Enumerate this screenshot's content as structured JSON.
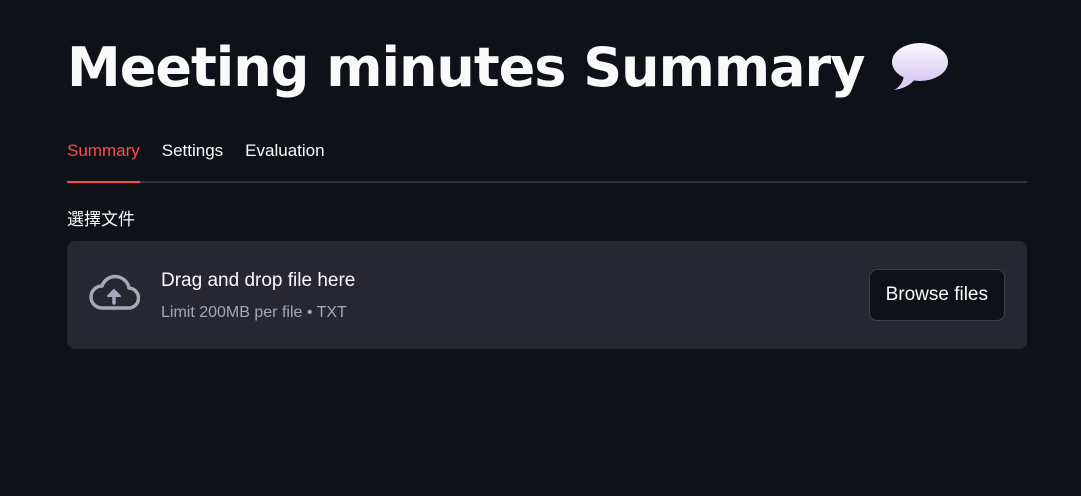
{
  "header": {
    "title": "Meeting minutes Summary",
    "title_icon": "speech-bubble-icon"
  },
  "tabs": [
    {
      "label": "Summary",
      "active": true
    },
    {
      "label": "Settings",
      "active": false
    },
    {
      "label": "Evaluation",
      "active": false
    }
  ],
  "uploader": {
    "label": "選擇文件",
    "icon": "cloud-upload-icon",
    "primary_text": "Drag and drop file here",
    "secondary_text": "Limit 200MB per file • TXT",
    "button_label": "Browse files"
  },
  "colors": {
    "background": "#0e1117",
    "accent": "#ff4b4b",
    "dropzone": "#262730",
    "muted_text": "#a3a8b8"
  }
}
